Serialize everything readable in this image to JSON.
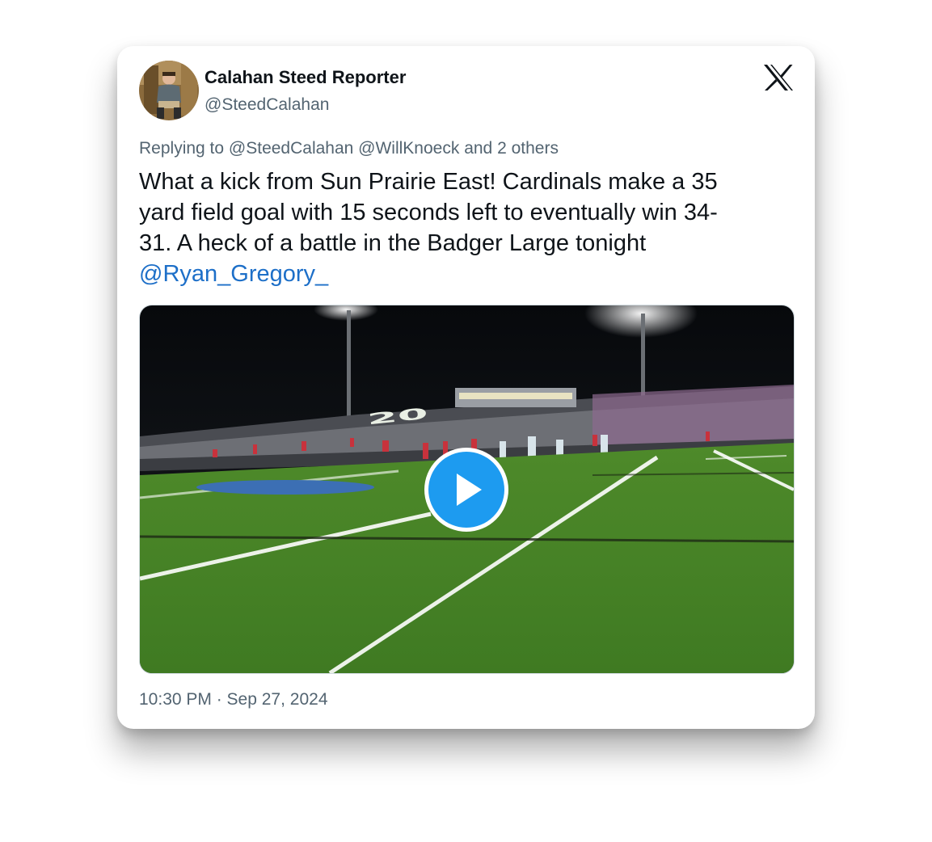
{
  "tweet": {
    "author_name": "Calahan Steed Reporter",
    "author_handle": "@SteedCalahan",
    "avatar_icon": "avatar-photo",
    "platform_icon": "x-logo-icon",
    "replying_prefix": "Replying to",
    "replying_mentions": "@SteedCalahan @WillKnoeck",
    "replying_suffix": "and 2 others",
    "text_lines": [
      "What a kick from Sun Prairie East! Cardinals make a 35",
      "yard field goal with 15 seconds left to eventually win 34-",
      "31. A heck of a battle in the Badger Large tonight"
    ],
    "mention": "@Ryan_Gregory_",
    "timestamp": "10:30 PM · Sep 27, 2024"
  },
  "media": {
    "type": "video",
    "play_icon": "play-icon",
    "accent_color": "#1d9bf0",
    "field_marking": "20"
  },
  "colors": {
    "text_primary": "#0f1419",
    "text_secondary": "#536471",
    "link": "#1d6fc8"
  }
}
